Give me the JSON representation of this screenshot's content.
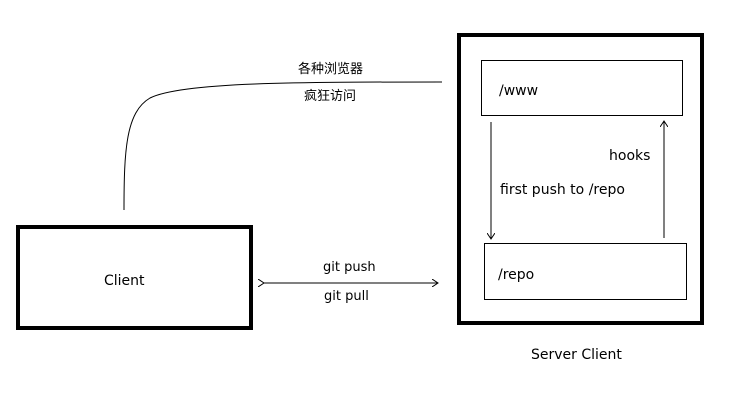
{
  "nodes": {
    "client": "Client",
    "server_caption": "Server Client",
    "www": "/www",
    "repo": "/repo"
  },
  "edges": {
    "browser_top": "各种浏览器",
    "browser_bottom": "疯狂访问",
    "git_push": "git push",
    "git_pull": "git pull",
    "first_push": "first push to /repo",
    "hooks": "hooks"
  },
  "colors": {
    "stroke": "#000000",
    "background": "#ffffff"
  }
}
